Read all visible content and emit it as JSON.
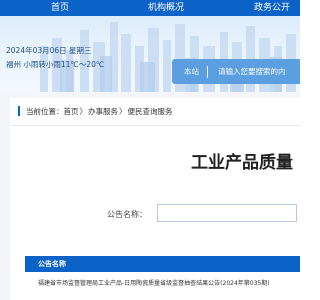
{
  "nav": {
    "items": [
      {
        "label": "首页"
      },
      {
        "label": "机构概况"
      },
      {
        "label": "政务公开"
      }
    ]
  },
  "banner": {
    "date": "2024年03月06日 星期三",
    "weather": "福州 小雨转小雨11℃～20℃",
    "search": {
      "scope_label": "本站",
      "placeholder": "请输入您要搜索的内"
    }
  },
  "breadcrumb": {
    "prefix": "当前位置：",
    "items": [
      "首页",
      "办事服务",
      "便民查询服务"
    ],
    "separator": "〉"
  },
  "page": {
    "title": "工业产品质量"
  },
  "form": {
    "name_label": "公告名称：",
    "name_value": ""
  },
  "table": {
    "header": "公告名称",
    "rows": [
      {
        "name": "福建省市场监督管理局工业产品-日用陶瓷质量省级监督抽查结果公告(2024年第035期)"
      }
    ]
  },
  "colors": {
    "primary": "#0b63c8",
    "banner_bg": "#e4effb",
    "page_bg": "#f3f5f8"
  }
}
